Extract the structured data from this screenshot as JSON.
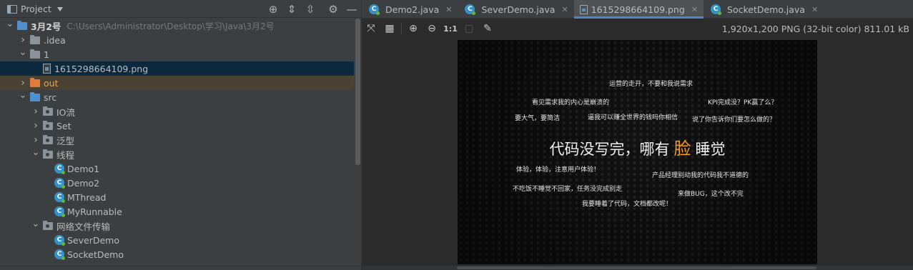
{
  "project_panel": {
    "title": "Project",
    "tools": [
      "crosshair-icon",
      "expand-all-icon",
      "collapse-all-icon",
      "gear-icon",
      "minimize-icon"
    ],
    "tree": [
      {
        "label": "3月2号",
        "hint": "C:\\Users\\Administrator\\Desktop\\学习\\Java\\3月2号",
        "depth": 0,
        "arrow": "down",
        "icon": "module-folder",
        "bold": true
      },
      {
        "label": ".idea",
        "depth": 1,
        "arrow": "right",
        "icon": "folder-grey"
      },
      {
        "label": "1",
        "depth": 1,
        "arrow": "down",
        "icon": "folder-grey"
      },
      {
        "label": "1615298664109.png",
        "depth": 2,
        "arrow": "none",
        "icon": "png-file",
        "selected": true
      },
      {
        "label": "out",
        "depth": 1,
        "arrow": "right",
        "icon": "folder-orange",
        "excluded": true
      },
      {
        "label": "src",
        "depth": 1,
        "arrow": "down",
        "icon": "folder-blue"
      },
      {
        "label": "IO流",
        "depth": 2,
        "arrow": "right",
        "icon": "package"
      },
      {
        "label": "Set",
        "depth": 2,
        "arrow": "right",
        "icon": "package"
      },
      {
        "label": "泛型",
        "depth": 2,
        "arrow": "right",
        "icon": "package"
      },
      {
        "label": "线程",
        "depth": 2,
        "arrow": "down",
        "icon": "package"
      },
      {
        "label": "Demo1",
        "depth": 3,
        "arrow": "none",
        "icon": "java-class"
      },
      {
        "label": "Demo2",
        "depth": 3,
        "arrow": "none",
        "icon": "java-class"
      },
      {
        "label": "MThread",
        "depth": 3,
        "arrow": "none",
        "icon": "java-class"
      },
      {
        "label": "MyRunnable",
        "depth": 3,
        "arrow": "none",
        "icon": "java-class"
      },
      {
        "label": "网络文件传输",
        "depth": 2,
        "arrow": "down",
        "icon": "package"
      },
      {
        "label": "SeverDemo",
        "depth": 3,
        "arrow": "none",
        "icon": "java-class"
      },
      {
        "label": "SocketDemo",
        "depth": 3,
        "arrow": "none",
        "icon": "java-class"
      }
    ]
  },
  "tabs": [
    {
      "label": "Demo2.java",
      "icon": "java-class",
      "active": false
    },
    {
      "label": "SeverDemo.java",
      "icon": "java-class",
      "active": false
    },
    {
      "label": "1615298664109.png",
      "icon": "image-file",
      "active": true
    },
    {
      "label": "SocketDemo.java",
      "icon": "java-class",
      "active": false
    }
  ],
  "image_toolbar": {
    "one_to_one": "1:1",
    "info": "1,920x1,200 PNG (32-bit color) 811.01 kB"
  },
  "image_content": {
    "headline_before": "代码没写完，哪有",
    "headline_face": "脸",
    "headline_after": "睡觉",
    "face_color": "#f39a1c",
    "phrases": [
      "运营的走开，不要和我说需求",
      "看见需求我的内心是崩溃的",
      "KPI完成没？PK赢了么？",
      "要大气，要简洁",
      "逼我可以赚全世界的钱吗你相信",
      "说了你告诉你们要怎么做的？",
      "体验，体验，注意用户体验！",
      "产品经理别动我的代码我不道德的",
      "不吃饭不睡觉不回家，任务没完成别走",
      "来做BUG，这个改不完",
      "我要睡着了代码，文档都改呢！"
    ]
  },
  "colors": {
    "selected_row": "#0d293e",
    "excluded_row": "#4a4233",
    "tab_underline": "#4a88c7"
  }
}
